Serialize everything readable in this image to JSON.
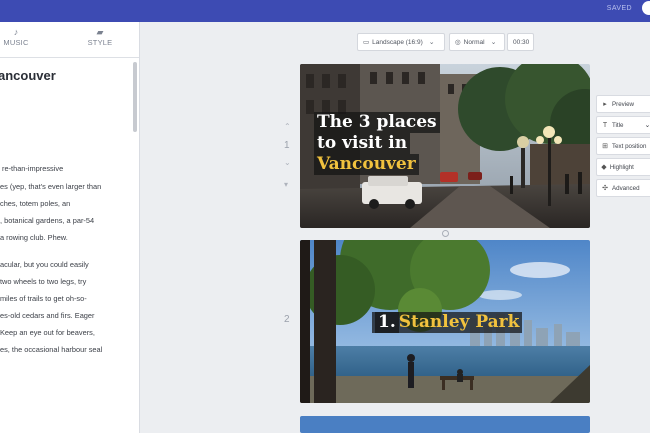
{
  "header": {
    "status": "SAVED"
  },
  "sidebar": {
    "tabs": [
      {
        "label": "MUSIC",
        "icon": "music-note-icon"
      },
      {
        "label": "STYLE",
        "icon": "style-icon"
      }
    ],
    "script_title": "ancouver",
    "script_lines": [
      "re-than-impressive",
      "es (yep, that's even larger than",
      "ches, totem poles, an",
      ", botanical gardens, a par-54",
      "a rowing club.  Phew.",
      "acular, but you could easily",
      "two wheels to two legs, try",
      "miles of trails to get oh-so-",
      "es-old cedars and firs.  Eager",
      "Keep an eye out for beavers,",
      "es, the occasional harbour seal"
    ]
  },
  "toolbar": {
    "format": "Landscape (16:9)",
    "speed": "Normal",
    "duration": "00:30"
  },
  "slides": [
    {
      "number": "1",
      "caption_lines": [
        "The 3 places",
        "to visit in",
        "Vancouver"
      ]
    },
    {
      "number": "2",
      "caption_prefix": "1. ",
      "caption_highlight": "Stanley Park"
    }
  ],
  "right_panel": {
    "items": [
      {
        "label": "Preview",
        "icon": "play-icon"
      },
      {
        "label": "Title",
        "icon": "text-type-icon"
      },
      {
        "label": "Text position",
        "icon": "text-position-icon"
      },
      {
        "label": "Highlight",
        "icon": "highlight-icon"
      },
      {
        "label": "Advanced",
        "icon": "settings-icon"
      }
    ]
  },
  "colors": {
    "header": "#3d4bb3",
    "caption_highlight": "#f1c23e"
  }
}
